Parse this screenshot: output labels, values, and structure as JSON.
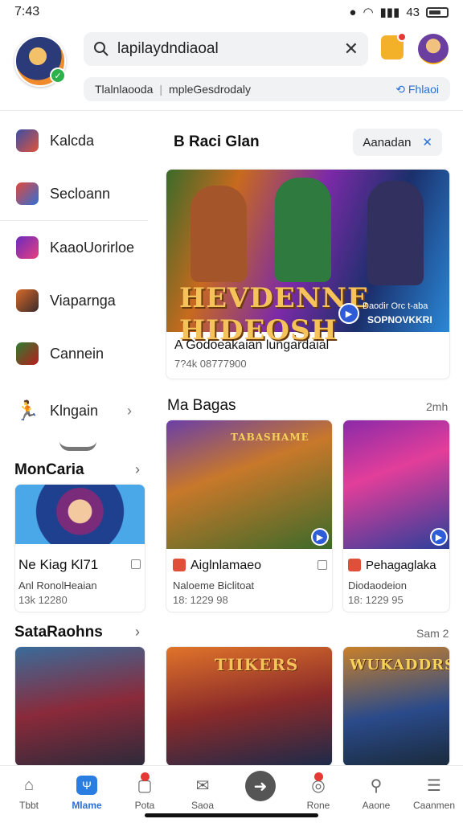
{
  "status_bar": {
    "time": "7:43",
    "signal": "43"
  },
  "header": {
    "search_value": "lapilaydndiaoal",
    "filter_left": "Tlalnlaooda",
    "filter_right": "mpleGesdrodaly",
    "filter_link": "Fhlaoi"
  },
  "sidebar": {
    "items": [
      {
        "label": "Kalcda",
        "icon": "game-icon"
      },
      {
        "label": "Secloann",
        "icon": "folder-icon"
      },
      {
        "label": "KaaoUorirloe",
        "icon": "controller-icon"
      },
      {
        "label": "Viaparnga",
        "icon": "hero-icon"
      },
      {
        "label": "Cannein",
        "icon": "character-icon"
      },
      {
        "label": "Klngain",
        "icon": "runner-icon"
      }
    ]
  },
  "featured": {
    "title": "B Raci Glan",
    "chip_label": "Aanadan",
    "art_title": "HEVDENNE HIDEOSH",
    "art_caption_top": "Daodir Orc t-aba",
    "art_caption_bottom": "SOPNOVKKRI",
    "card_title": "A Godoeakaian lungardaial",
    "card_meta": "7?4k 08777900"
  },
  "left_section": {
    "title": "MonCaria",
    "card_title": "Ne Kiag Kl71",
    "card_sub": "Anl RonolHeaian",
    "card_meta": "13k 12280"
  },
  "middle_section": {
    "title": "Ma Bagas",
    "more": "2mh",
    "cards": [
      {
        "art_title": "TABASHAME",
        "title": "Aiglnlamaeo",
        "sub": "Naloeme Biclitoat",
        "meta": "18: 1229 98"
      },
      {
        "art_title": "",
        "title": "Pehagaglaka",
        "sub": "Diodaodeion",
        "meta": "18: 1229 95"
      }
    ]
  },
  "bottom_section": {
    "title": "SataRaohns",
    "more": "Sam 2",
    "cards": [
      {
        "art_title": ""
      },
      {
        "art_title": "TIIKERS"
      },
      {
        "art_title": "WUKADDRS"
      }
    ]
  },
  "bottom_nav": [
    {
      "label": "Tbbt",
      "icon": "home-icon"
    },
    {
      "label": "Mlame",
      "icon": "apps-icon"
    },
    {
      "label": "Pota",
      "icon": "gift-icon"
    },
    {
      "label": "Saoa",
      "icon": "mail-icon"
    },
    {
      "label": "",
      "icon": "play-icon"
    },
    {
      "label": "Rone",
      "icon": "medal-icon"
    },
    {
      "label": "Aaone",
      "icon": "search-icon"
    },
    {
      "label": "Caanmen",
      "icon": "stack-icon"
    }
  ]
}
